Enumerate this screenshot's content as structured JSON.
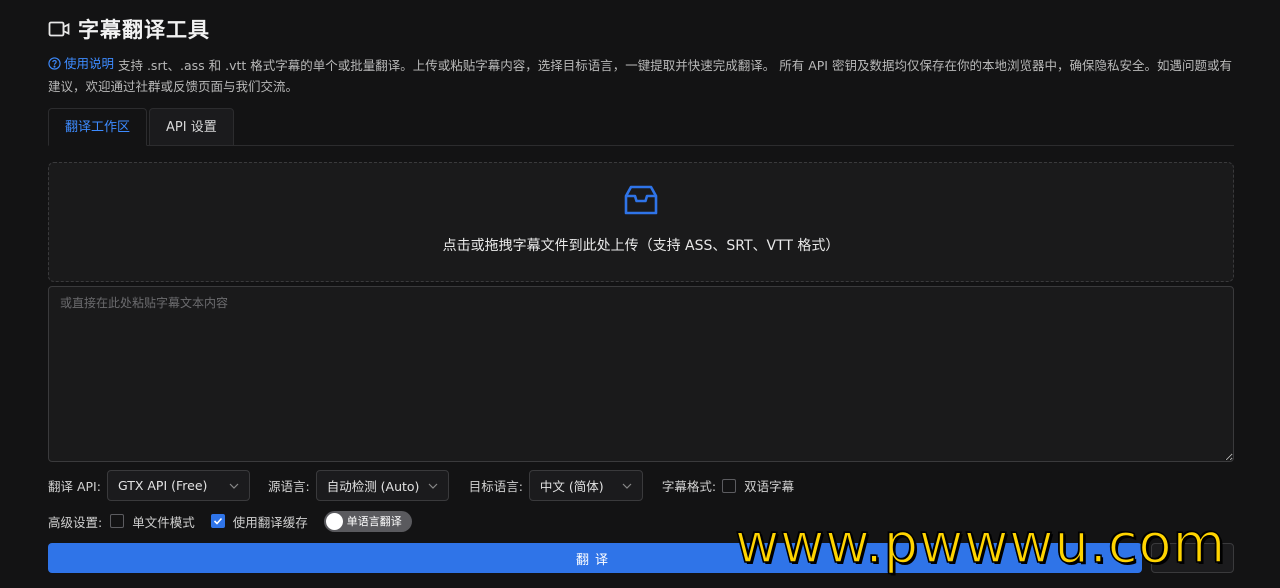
{
  "header": {
    "title": "字幕翻译工具",
    "icon": "video-icon"
  },
  "description": {
    "help_link": "使用说明",
    "text": " 支持 .srt、.ass 和 .vtt 格式字幕的单个或批量翻译。上传或粘贴字幕内容，选择目标语言，一键提取并快速完成翻译。 所有 API 密钥及数据均仅保存在你的本地浏览器中，确保隐私安全。如遇问题或有建议，欢迎通过社群或反馈页面与我们交流。"
  },
  "tabs": [
    {
      "label": "翻译工作区",
      "active": true
    },
    {
      "label": "API 设置",
      "active": false
    }
  ],
  "upload": {
    "icon": "inbox-icon",
    "text": "点击或拖拽字幕文件到此处上传（支持 ASS、SRT、VTT 格式）"
  },
  "paste": {
    "placeholder": "或直接在此处粘贴字幕文本内容",
    "value": ""
  },
  "options": {
    "api_label": "翻译 API:",
    "api_value": "GTX API (Free)",
    "source_label": "源语言:",
    "source_value": "自动检测 (Auto)",
    "target_label": "目标语言:",
    "target_value": "中文 (简体)",
    "format_label": "字幕格式:",
    "bilingual_label": "双语字幕",
    "bilingual_checked": false
  },
  "advanced": {
    "label": "高级设置:",
    "single_file_label": "单文件模式",
    "single_file_checked": false,
    "cache_label": "使用翻译缓存",
    "cache_checked": true,
    "switch_label": "单语言翻译",
    "switch_on": false
  },
  "actions": {
    "translate_label": "翻译",
    "second_label": ""
  },
  "watermark": "www.pwwwu.com",
  "colors": {
    "accent": "#2f74e8",
    "link": "#3d8bff",
    "background": "#131314",
    "watermark": "#ffd400"
  }
}
